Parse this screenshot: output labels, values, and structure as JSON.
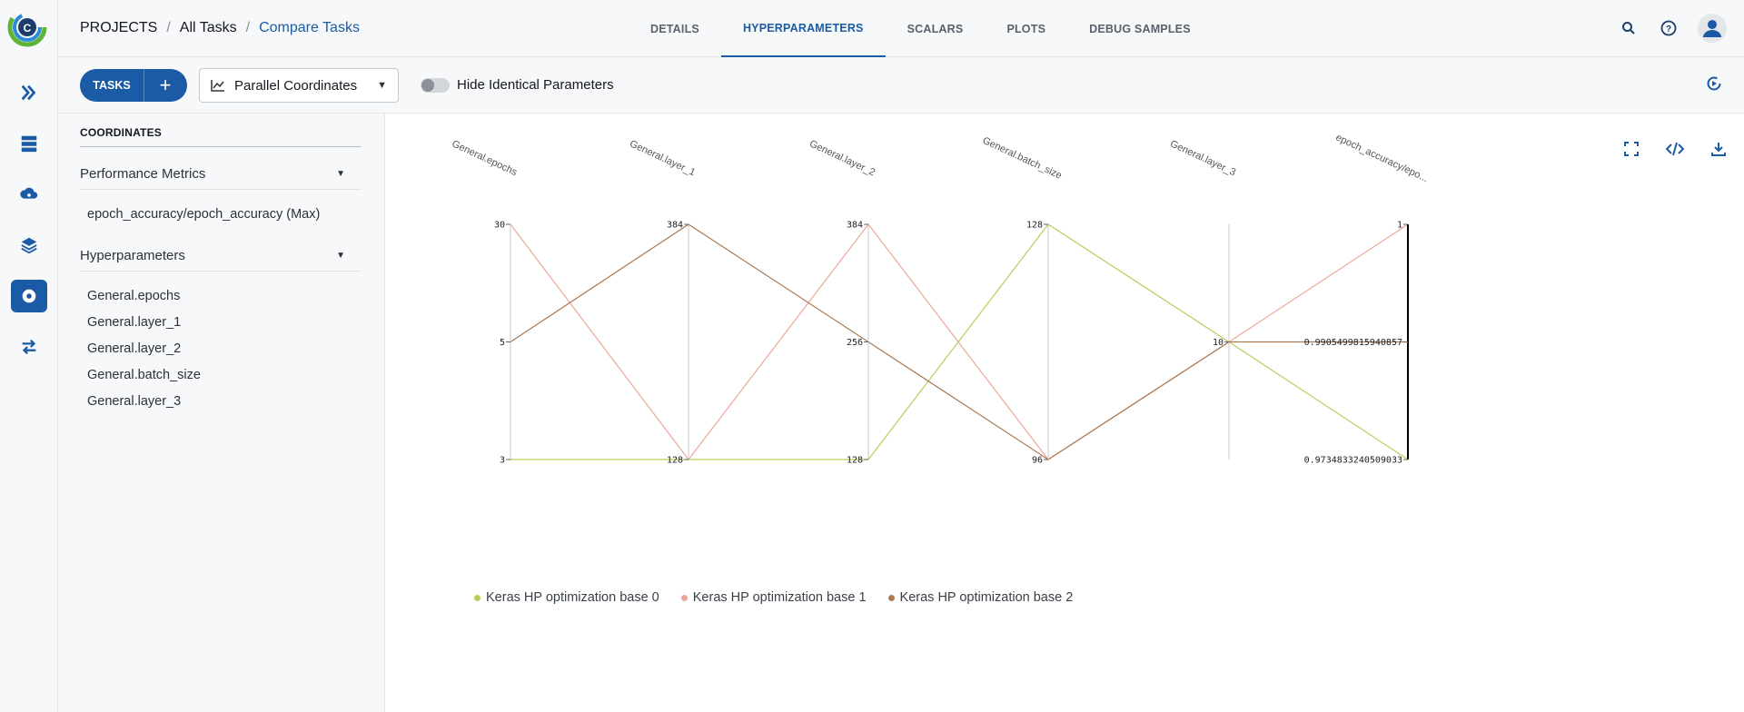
{
  "breadcrumb": {
    "root": "PROJECTS",
    "sep": "/",
    "parent": "All Tasks",
    "current": "Compare Tasks"
  },
  "tabs": [
    {
      "label": "DETAILS",
      "active": false
    },
    {
      "label": "HYPERPARAMETERS",
      "active": true
    },
    {
      "label": "SCALARS",
      "active": false
    },
    {
      "label": "PLOTS",
      "active": false
    },
    {
      "label": "DEBUG SAMPLES",
      "active": false
    }
  ],
  "header_icons": [
    "search-icon",
    "help-icon",
    "user-avatar-icon"
  ],
  "toolbar": {
    "tasks_label": "TASKS",
    "add_label": "+",
    "view_value": "Parallel Coordinates",
    "toggle_label": "Hide Identical Parameters",
    "toggle_on": false
  },
  "panel": {
    "title": "COORDINATES",
    "metrics_section": "Performance Metrics",
    "metrics": [
      "epoch_accuracy/epoch_accuracy (Max)"
    ],
    "hparams_section": "Hyperparameters",
    "hparams": [
      "General.epochs",
      "General.layer_1",
      "General.layer_2",
      "General.batch_size",
      "General.layer_3"
    ]
  },
  "colors": {
    "accent": "#1b5aa4",
    "series0": "#b5cf5a",
    "series1": "#eea69a",
    "series2": "#a87a55"
  },
  "chart_data": {
    "type": "parallel-coordinates",
    "axes": [
      {
        "name": "General.epochs",
        "ticks": [
          "30",
          "5",
          "3"
        ],
        "tick_values": [
          30,
          5,
          3
        ],
        "range": [
          3,
          30
        ]
      },
      {
        "name": "General.layer_1",
        "ticks": [
          "384",
          "128"
        ],
        "tick_values": [
          384,
          128
        ],
        "range": [
          128,
          384
        ]
      },
      {
        "name": "General.layer_2",
        "ticks": [
          "384",
          "256",
          "128"
        ],
        "tick_values": [
          384,
          256,
          128
        ],
        "range": [
          128,
          384
        ]
      },
      {
        "name": "General.batch_size",
        "ticks": [
          "128",
          "96"
        ],
        "tick_values": [
          128,
          96
        ],
        "range": [
          96,
          128
        ]
      },
      {
        "name": "General.layer_3",
        "ticks": [
          "10"
        ],
        "tick_values": [
          10
        ],
        "range": [
          10,
          10
        ]
      },
      {
        "name": "epoch_accuracy/epo...",
        "ticks": [
          "1",
          "0.9905499815940857",
          "0.9734833240509033"
        ],
        "tick_values": [
          1,
          0.9905499815940857,
          0.9734833240509033
        ],
        "range": [
          0.9734833240509033,
          1
        ]
      }
    ],
    "series": [
      {
        "name": "Keras HP optimization base 0",
        "values": [
          3,
          128,
          128,
          128,
          10,
          0.9734833240509033
        ]
      },
      {
        "name": "Keras HP optimization base 1",
        "values": [
          30,
          128,
          384,
          96,
          10,
          1
        ]
      },
      {
        "name": "Keras HP optimization base 2",
        "values": [
          5,
          384,
          256,
          96,
          10,
          0.9905499815940857
        ]
      }
    ]
  }
}
